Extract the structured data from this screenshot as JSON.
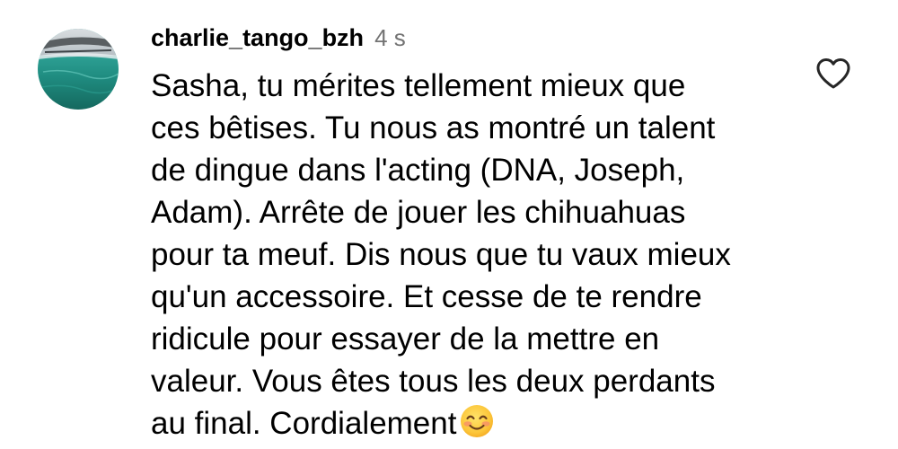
{
  "comment": {
    "username": "charlie_tango_bzh",
    "timestamp": "4 s",
    "text": "Sasha, tu mérites tellement mieux que\nces bêtises. Tu nous as montré un talent\nde dingue dans l'acting (DNA, Joseph,\nAdam). Arrête de jouer les chihuahuas\npour ta meuf. Dis nous que tu vaux mieux\nqu'un accessoire. Et cesse de te rendre\nridicule pour essayer de la mettre en\nvaleur. Vous êtes tous les deux perdants\nau final. Cordialement",
    "emoji": "smiling-face-emoji",
    "like_icon": "heart-outline-icon"
  },
  "colors": {
    "text": "#000000",
    "timestamp": "#737373",
    "icon": "#262626",
    "background": "#ffffff"
  }
}
